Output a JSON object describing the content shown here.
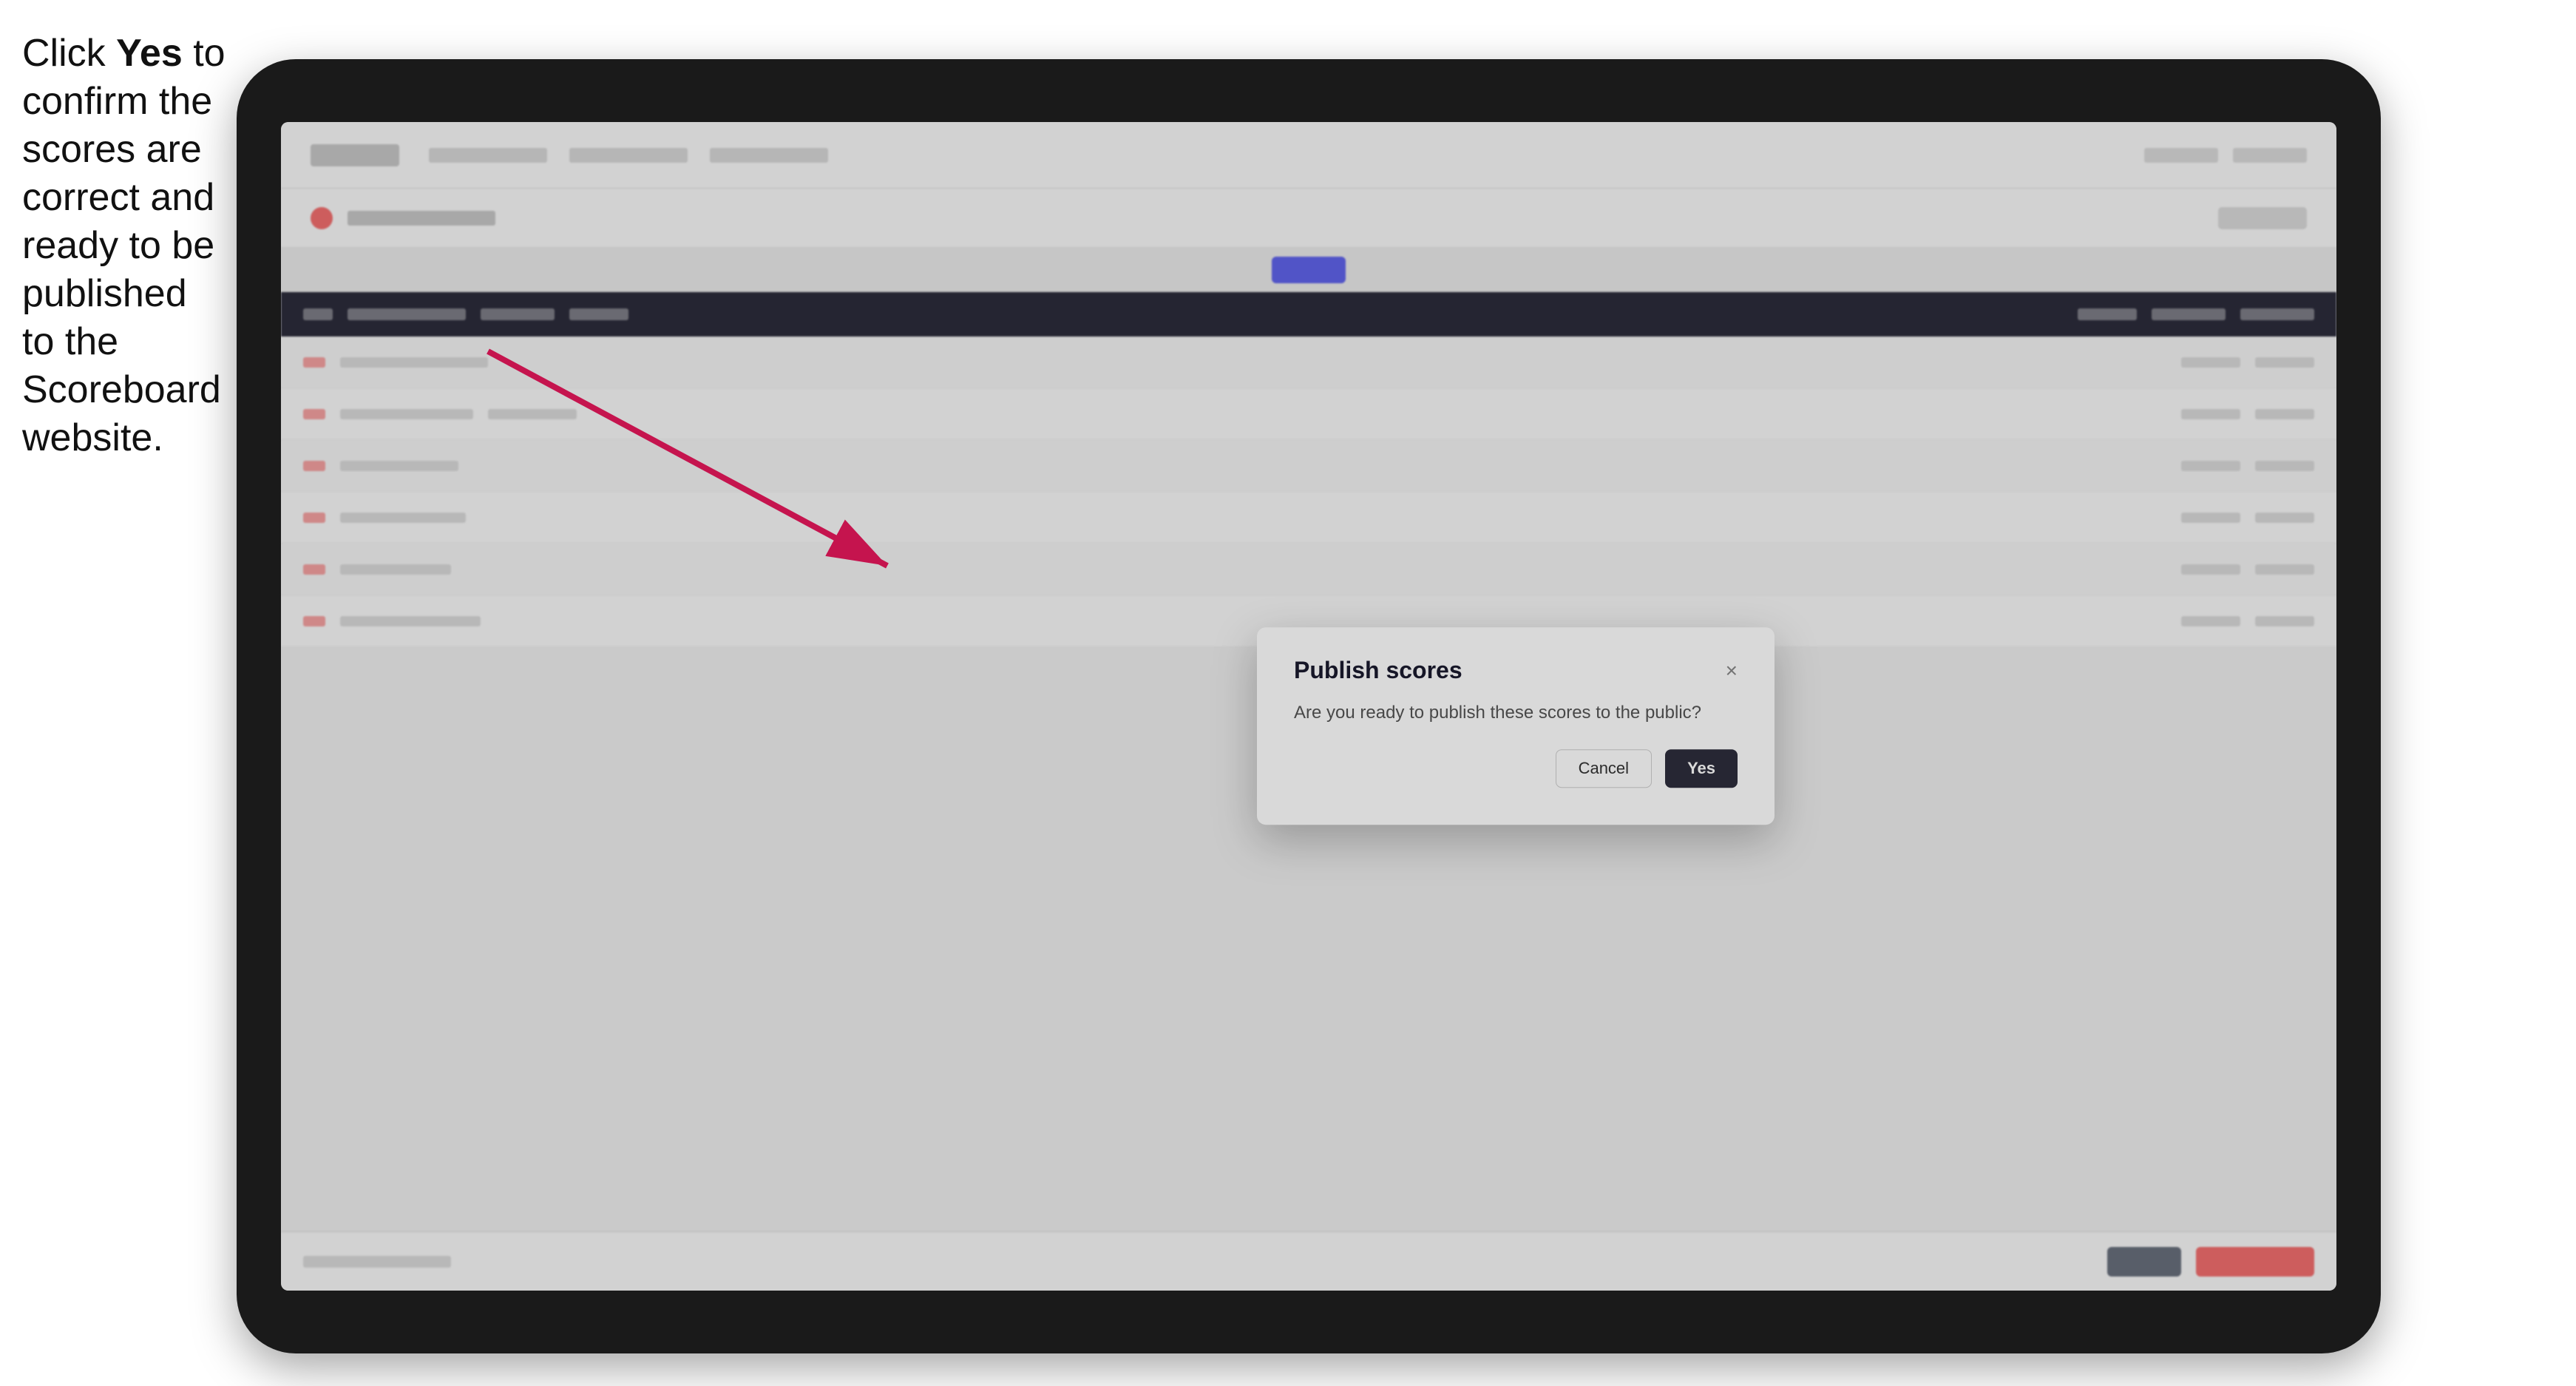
{
  "annotation": {
    "text_part1": "Click ",
    "text_bold": "Yes",
    "text_part2": " to confirm the scores are correct and ready to be published to the Scoreboard website."
  },
  "modal": {
    "title": "Publish scores",
    "body_text": "Are you ready to publish these scores to the public?",
    "cancel_label": "Cancel",
    "yes_label": "Yes",
    "close_icon": "×"
  },
  "colors": {
    "yes_btn_bg": "#2d2d3d",
    "cancel_btn_bg": "#ffffff",
    "arrow_color": "#e8185c"
  }
}
